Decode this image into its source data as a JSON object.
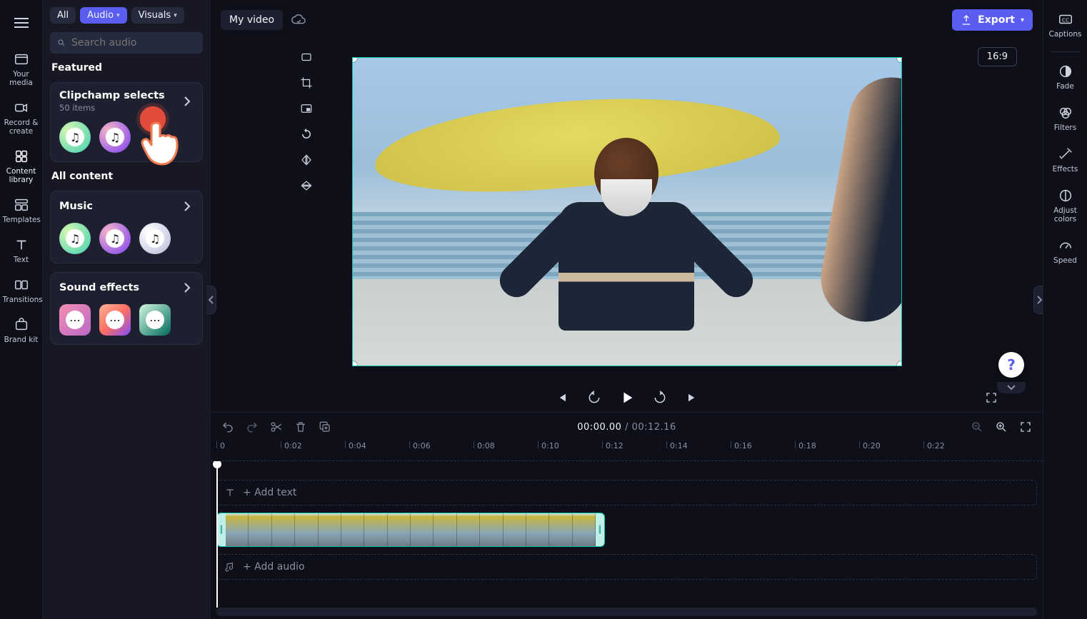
{
  "leftRail": {
    "items": [
      {
        "name": "your-media",
        "label": "Your media"
      },
      {
        "name": "record-create",
        "label": "Record & create"
      },
      {
        "name": "content-library",
        "label": "Content library"
      },
      {
        "name": "templates",
        "label": "Templates"
      },
      {
        "name": "text",
        "label": "Text"
      },
      {
        "name": "transitions",
        "label": "Transitions"
      },
      {
        "name": "brand-kit",
        "label": "Brand kit"
      }
    ]
  },
  "library": {
    "tabs": {
      "all": "All",
      "audio": "Audio",
      "visuals": "Visuals"
    },
    "search_placeholder": "Search audio",
    "featured_label": "Featured",
    "featured_card": {
      "title": "Clipchamp selects",
      "subtitle": "50 items"
    },
    "allcontent_label": "All content",
    "music_card": {
      "title": "Music"
    },
    "sfx_card": {
      "title": "Sound effects"
    }
  },
  "topbar": {
    "project_name": "My video",
    "export_label": "Export",
    "aspect": "16:9"
  },
  "playback": {
    "current": "00:00.00",
    "total": "00:12.16"
  },
  "ruler": {
    "ticks": [
      "0",
      "0:02",
      "0:04",
      "0:06",
      "0:08",
      "0:10",
      "0:12",
      "0:14",
      "0:16",
      "0:18",
      "0:20",
      "0:22"
    ]
  },
  "tracks": {
    "text_placeholder": "+ Add text",
    "audio_placeholder": "+ Add audio"
  },
  "rightRail": {
    "items": [
      {
        "name": "captions",
        "label": "Captions"
      },
      {
        "name": "fade",
        "label": "Fade"
      },
      {
        "name": "filters",
        "label": "Filters"
      },
      {
        "name": "effects",
        "label": "Effects"
      },
      {
        "name": "adjust-colors",
        "label": "Adjust colors"
      },
      {
        "name": "speed",
        "label": "Speed"
      }
    ]
  },
  "help": {
    "glyph": "?"
  }
}
